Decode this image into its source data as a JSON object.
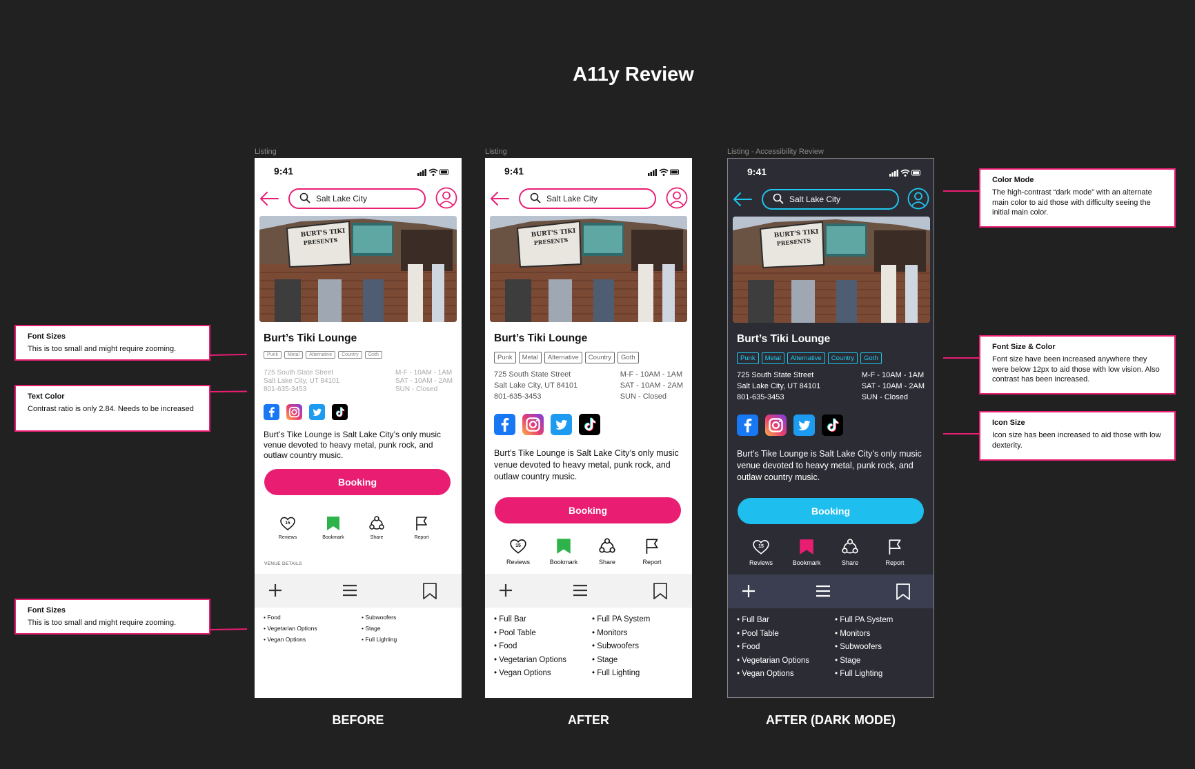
{
  "title": "A11y Review",
  "frames": [
    {
      "label": "Listing",
      "footer": "BEFORE"
    },
    {
      "label": "Listing",
      "footer": "AFTER"
    },
    {
      "label": "Listing - Accessibility Review",
      "footer": "AFTER (DARK MODE)"
    }
  ],
  "phone": {
    "time": "9:41",
    "search_value": "Salt Lake City",
    "venue_name": "Burt’s Tiki Lounge",
    "tags": [
      "Punk",
      "Metal",
      "Alternative",
      "Country",
      "Goth"
    ],
    "address": [
      "725 South State Street",
      "Salt Lake City, UT 84101",
      "801-635-3453"
    ],
    "hours": [
      "M-F - 10AM - 1AM",
      "SAT - 10AM - 2AM",
      "SUN - Closed"
    ],
    "description": "Burt’s Tike Lounge is Salt Lake City’s only music venue devoted to heavy metal, punk rock, and outlaw country music.",
    "booking": "Booking",
    "reviews_count": "15",
    "actions": [
      "Reviews",
      "Bookmark",
      "Share",
      "Report"
    ],
    "venue_details": "VENUE DETAILS",
    "amenities_before_left": [
      "• Food",
      "• Vegetarian Options",
      "• Vegan Options"
    ],
    "amenities_before_right": [
      "• Subwoofers",
      "• Stage",
      "• Full Lighting"
    ],
    "amenities_left": [
      "• Full Bar",
      "• Pool Table",
      "• Food",
      "• Vegetarian Options",
      "• Vegan Options"
    ],
    "amenities_right": [
      "• Full PA System",
      "• Monitors",
      "• Subwoofers",
      "• Stage",
      "• Full Lighting"
    ]
  },
  "notes": {
    "left": [
      {
        "title": "Font Sizes",
        "body": "This is too small and might require zooming."
      },
      {
        "title": "Text Color",
        "body": "Contrast ratio is only 2.84. Needs to be increased"
      },
      {
        "title": "Font Sizes",
        "body": "This is too small and might require zooming."
      }
    ],
    "right": [
      {
        "title": "Color Mode",
        "body": "The high-contrast “dark mode” with an alternate main color to aid those with difficulty seeing the initial main color."
      },
      {
        "title": "Font Size & Color",
        "body": "Font size have been increased anywhere they were below 12px to aid those with low vision. Also contrast has been increased."
      },
      {
        "title": "Icon Size",
        "body": "Icon size has been increased to aid those with low dexterity."
      }
    ]
  },
  "colors": {
    "background": "#212121",
    "accent_pink": "#e91e73",
    "accent_blue": "#1ec8f0",
    "dark_surface": "#2c2c35",
    "bookmark_green": "#2db34a"
  },
  "icons": [
    "back-arrow-icon",
    "search-icon",
    "profile-icon",
    "facebook-icon",
    "instagram-icon",
    "twitter-icon",
    "tiktok-icon",
    "heart-icon",
    "bookmark-icon",
    "share-icon",
    "flag-icon",
    "plus-icon",
    "menu-icon",
    "bookmark-outline-icon"
  ]
}
